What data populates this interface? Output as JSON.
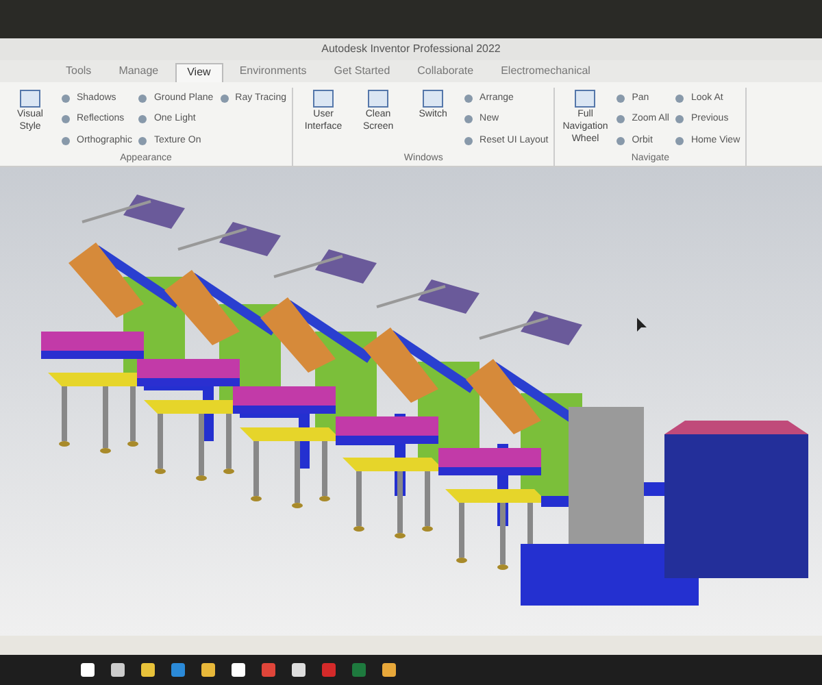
{
  "window": {
    "title": "Autodesk Inventor Professional 2022"
  },
  "ribbon_tabs": [
    {
      "label": "Tools",
      "selected": false
    },
    {
      "label": "Manage",
      "selected": false
    },
    {
      "label": "View",
      "selected": true
    },
    {
      "label": "Environments",
      "selected": false
    },
    {
      "label": "Get Started",
      "selected": false
    },
    {
      "label": "Collaborate",
      "selected": false
    },
    {
      "label": "Electromechanical",
      "selected": false
    }
  ],
  "panels": [
    {
      "title": "Appearance",
      "large": [
        "Visual Style"
      ],
      "small": [
        "Shadows",
        "Reflections",
        "Orthographic",
        "Ground Plane",
        "One Light",
        "Texture On",
        "Ray Tracing"
      ]
    },
    {
      "title": "Windows",
      "large": [
        "User Interface",
        "Clean Screen",
        "Switch"
      ],
      "small": [
        "Arrange",
        "New",
        "Reset UI Layout"
      ]
    },
    {
      "title": "Navigate",
      "large": [
        "Full Navigation Wheel"
      ],
      "small": [
        "Pan",
        "Zoom All",
        "Orbit",
        "Look At",
        "Previous",
        "Home View"
      ]
    }
  ]
}
